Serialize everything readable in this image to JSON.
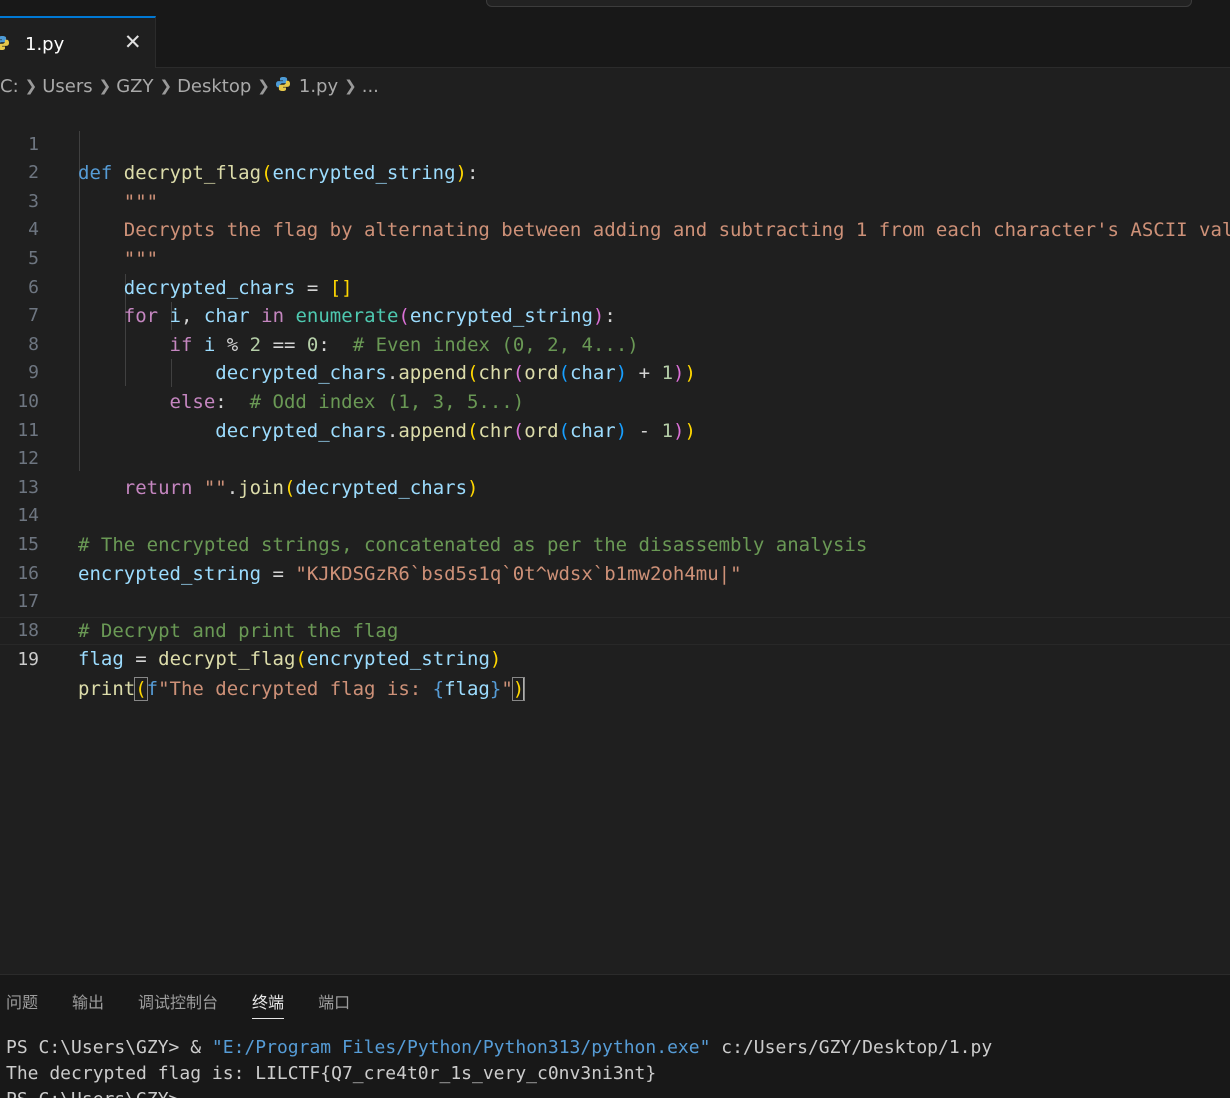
{
  "tab": {
    "label": "1.py",
    "close": "✕"
  },
  "breadcrumb": [
    "C:",
    "Users",
    "GZY",
    "Desktop",
    "1.py",
    "..."
  ],
  "editor": {
    "line_numbers": [
      "1",
      "2",
      "3",
      "4",
      "5",
      "6",
      "7",
      "8",
      "9",
      "10",
      "11",
      "12",
      "13",
      "14",
      "15",
      "16",
      "17",
      "18",
      "19"
    ],
    "active_line": "19"
  },
  "panel": {
    "tabs": [
      "问题",
      "输出",
      "调试控制台",
      "终端",
      "端口"
    ],
    "active_tab": "终端",
    "terminal": {
      "prompt": "PS C:\\Users\\GZY> ",
      "amp": "& ",
      "exe": "\"E:/Program Files/Python/Python313/python.exe\"",
      "script": " c:/Users/GZY/Desktop/1.py",
      "output": "The decrypted flag is: LILCTF{Q7_cre4t0r_1s_very_c0nv3ni3nt}",
      "prompt2": "PS C:\\Users\\GZY>"
    }
  },
  "colors": {
    "accent": "#0078d4",
    "background": "#1f1f1f",
    "keyword": "#569cd6",
    "string": "#ce9178",
    "comment": "#6a9955"
  }
}
